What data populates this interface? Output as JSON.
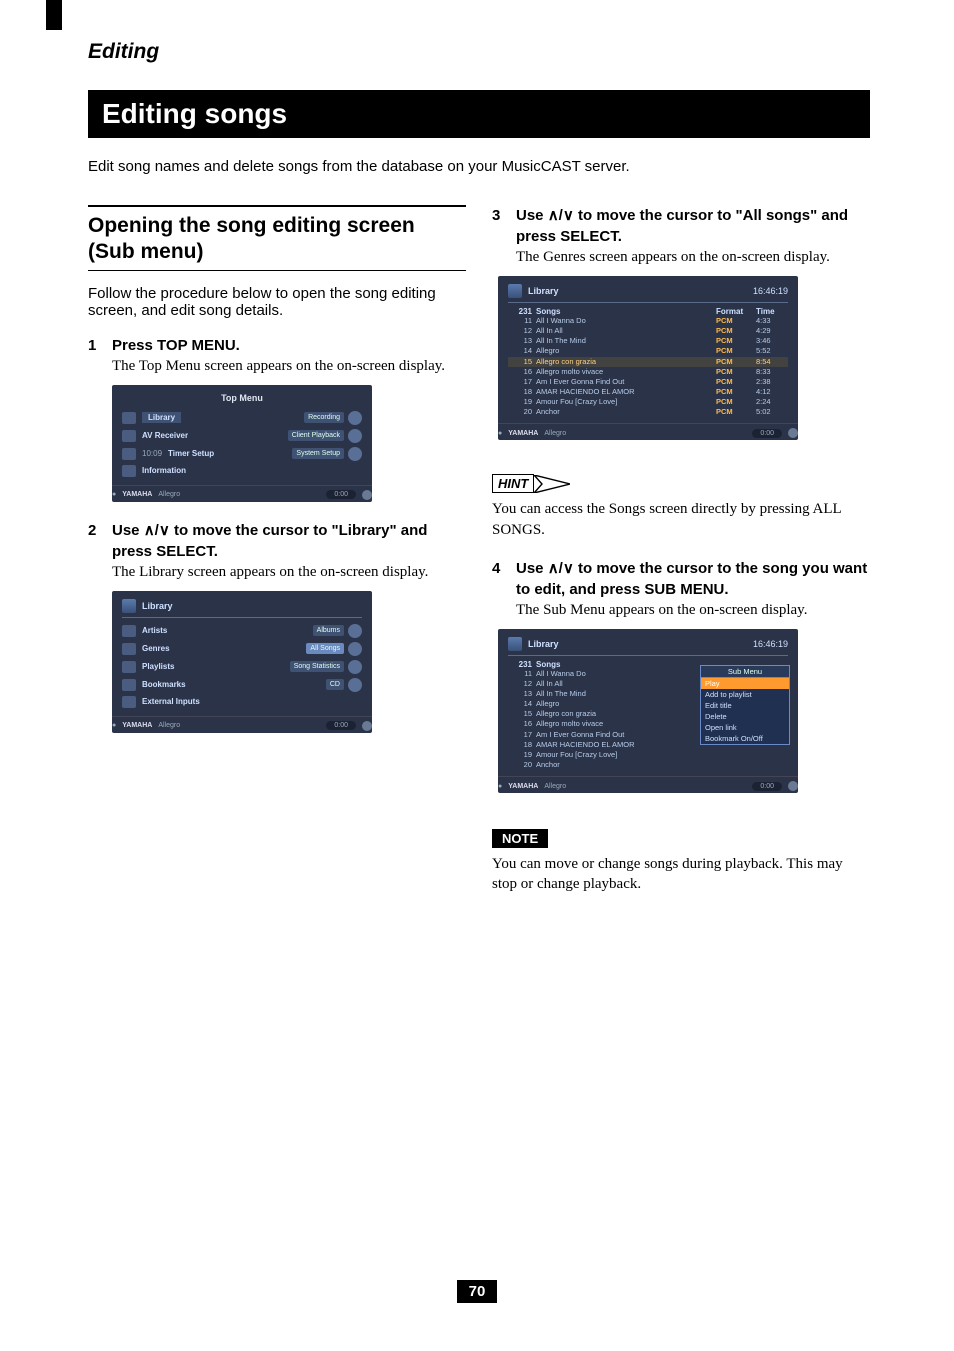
{
  "header": {
    "section": "Editing",
    "title": "Editing songs"
  },
  "intro": "Edit song names and delete songs from the database on your MusicCAST server.",
  "left": {
    "subhead": "Opening the song editing screen (Sub menu)",
    "lead": "Follow the procedure below to open the song editing screen, and edit song details.",
    "step1": {
      "num": "1",
      "title": "Press TOP MENU.",
      "desc": "The Top Menu screen appears on the on-screen display."
    },
    "step2": {
      "num": "2",
      "title_a": "Use ",
      "title_b": " to move the cursor to \"Library\" and press SELECT.",
      "arrows": "∧/∨",
      "desc": "The Library screen appears on the on-screen display."
    }
  },
  "right": {
    "step3": {
      "num": "3",
      "title_a": "Use ",
      "title_b": " to move the cursor to \"All songs\" and press SELECT.",
      "arrows": "∧/∨",
      "desc": "The Genres screen appears on the on-screen display."
    },
    "step4": {
      "num": "4",
      "title_a": "Use ",
      "title_b": " to move the cursor to the song you want to edit, and press SUB MENU.",
      "arrows": "∧/∨",
      "desc": "The Sub Menu appears on the on-screen display."
    },
    "hint": {
      "label": "HINT",
      "text": "You can access the Songs screen directly by pressing ALL SONGS."
    },
    "note": {
      "label": "NOTE",
      "text": "You can move or change songs during playback. This may stop or change playback."
    }
  },
  "screens": {
    "now_playing": {
      "brand": "YAMAHA",
      "track": "Allegro",
      "time": "0:00"
    },
    "topmenu": {
      "title": "Top Menu",
      "left_items": [
        {
          "label": "Library",
          "hl": true,
          "icon": "library"
        },
        {
          "label": "AV Receiver",
          "icon": "av"
        },
        {
          "label": "Timer Setup",
          "icon": "timer",
          "prefix": "10:09"
        },
        {
          "label": "Information",
          "icon": "info"
        }
      ],
      "right_items": [
        "Recording",
        "Client Playback",
        "System Setup"
      ]
    },
    "library": {
      "title": "Library",
      "left_items": [
        {
          "label": "Artists"
        },
        {
          "label": "Genres"
        },
        {
          "label": "Playlists"
        },
        {
          "label": "Bookmarks"
        },
        {
          "label": "External Inputs"
        }
      ],
      "right_items": [
        "Albums",
        "All Songs",
        "Song Statistics",
        "CD"
      ]
    },
    "songs": {
      "clock": "16:46:19",
      "lib_label": "Library",
      "count": "231",
      "col_songs": "Songs",
      "col_format": "Format",
      "col_time": "Time",
      "hl_index": 4,
      "rows": [
        {
          "n": "11",
          "name": "All I Wanna Do",
          "fmt": "PCM",
          "t": "4:33"
        },
        {
          "n": "12",
          "name": "All In All",
          "fmt": "PCM",
          "t": "4:29"
        },
        {
          "n": "13",
          "name": "All In The Mind",
          "fmt": "PCM",
          "t": "3:46"
        },
        {
          "n": "14",
          "name": "Allegro",
          "fmt": "PCM",
          "t": "5:52"
        },
        {
          "n": "15",
          "name": "Allegro con grazia",
          "fmt": "PCM",
          "t": "8:54"
        },
        {
          "n": "16",
          "name": "Allegro molto vivace",
          "fmt": "PCM",
          "t": "8:33"
        },
        {
          "n": "17",
          "name": "Am I Ever Gonna Find Out",
          "fmt": "PCM",
          "t": "2:38"
        },
        {
          "n": "18",
          "name": "AMAR HACIENDO EL AMOR",
          "fmt": "PCM",
          "t": "4:12"
        },
        {
          "n": "19",
          "name": "Amour Fou [Crazy Love]",
          "fmt": "PCM",
          "t": "2:24"
        },
        {
          "n": "20",
          "name": "Anchor",
          "fmt": "PCM",
          "t": "5:02"
        }
      ]
    },
    "submenu": {
      "title": "Sub Menu",
      "items": [
        "Play",
        "Add to playlist",
        "Edit title",
        "Delete",
        "Open link",
        "Bookmark On/Off"
      ],
      "selected": 0,
      "songs_simple": [
        {
          "n": "11",
          "name": "All I Wanna Do"
        },
        {
          "n": "12",
          "name": "All In All"
        },
        {
          "n": "13",
          "name": "All In The Mind"
        },
        {
          "n": "14",
          "name": "Allegro"
        },
        {
          "n": "15",
          "name": "Allegro con grazia"
        },
        {
          "n": "16",
          "name": "Allegro molto vivace"
        },
        {
          "n": "17",
          "name": "Am I Ever Gonna Find Out"
        },
        {
          "n": "18",
          "name": "AMAR HACIENDO EL AMOR"
        },
        {
          "n": "19",
          "name": "Amour Fou [Crazy Love]"
        },
        {
          "n": "20",
          "name": "Anchor"
        }
      ]
    }
  },
  "page_number": "70"
}
